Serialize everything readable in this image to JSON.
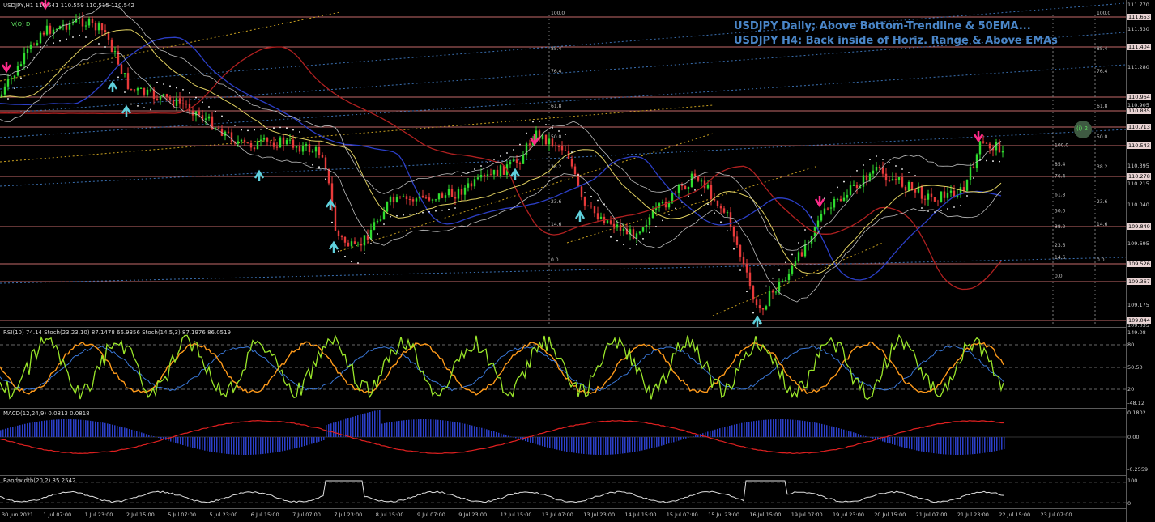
{
  "symbol_bar": "USDJPY,H1  110.541 110.559 110.515 110.542",
  "mode_badge": "V(O) D",
  "annotations": [
    "USDJPY Daily; Above Bottom-Trendline & 50EMA...",
    "USDJPY H4: Back inside of Horiz. Range & Above EMAs"
  ],
  "wave_label": "(i) 2",
  "price_axis": [
    "111.770",
    "111.653",
    "111.530",
    "111.404",
    "111.280",
    "110.964",
    "110.905",
    "110.835",
    "110.713",
    "110.543",
    "110.395",
    "110.278",
    "110.215",
    "110.040",
    "109.849",
    "109.695",
    "109.526",
    "109.367",
    "109.175",
    "109.044",
    "109.035"
  ],
  "highlight_prices": [
    "111.653",
    "111.404",
    "110.964",
    "110.835",
    "110.713",
    "110.543",
    "110.278",
    "109.849",
    "109.526",
    "109.367",
    "109.044"
  ],
  "fib_left": [
    "100.0",
    "85.4",
    "76.4",
    "61.8",
    "50.0",
    "38.2",
    "23.6",
    "14.6",
    "0.0"
  ],
  "fib_right": [
    "100.0",
    "85.4",
    "76.4",
    "61.8",
    "50.0",
    "38.2",
    "23.6",
    "14.6",
    "0.0"
  ],
  "fib_mid": [
    "100.0",
    "85.4",
    "76.4",
    "61.8",
    "50.0",
    "38.2",
    "23.6",
    "14.6",
    "0.0"
  ],
  "stoch_header": "RSI(10) 74.14  Stoch(23,23,10) 87.1478 66.9356  Stoch(14,5,3) 87.1976 86.0519",
  "stoch_axis": [
    "149.08",
    "80",
    "50.50",
    "20",
    "-48.12"
  ],
  "macd_header": "MACD(12,24,9) 0.0813 0.0818",
  "macd_axis": [
    "0.1802",
    "0.00",
    "-0.2559"
  ],
  "bandwidth_header": "Bandwidth(20,2) 35.2542",
  "bandwidth_axis": [
    "100",
    "0"
  ],
  "time_labels": [
    "30 Jun 2021",
    "1 Jul 07:00",
    "1 Jul 23:00",
    "2 Jul 15:00",
    "5 Jul 07:00",
    "5 Jul 23:00",
    "6 Jul 15:00",
    "7 Jul 07:00",
    "7 Jul 23:00",
    "8 Jul 15:00",
    "9 Jul 07:00",
    "9 Jul 23:00",
    "12 Jul 15:00",
    "13 Jul 07:00",
    "13 Jul 23:00",
    "14 Jul 15:00",
    "15 Jul 07:00",
    "15 Jul 23:00",
    "16 Jul 15:00",
    "19 Jul 07:00",
    "19 Jul 23:00",
    "20 Jul 15:00",
    "21 Jul 07:00",
    "21 Jul 23:00",
    "22 Jul 15:00",
    "23 Jul 07:00"
  ],
  "colors": {
    "background": "#000000",
    "bull_candle": "#2fdc2f",
    "bear_candle": "#e83a3a",
    "level_line": "#c46a6a",
    "annotation": "#4a86c8",
    "sell_arrow": "#ff2a8a",
    "buy_arrow": "#5fd0dc",
    "rsi": "#9ae62a",
    "stoch_fast": "#ff9a1a",
    "stoch_slow": "#3a78d8",
    "macd_hist": "#2b3fc8",
    "macd_signal": "#e02020",
    "bandwidth": "#e0e0e0"
  },
  "icons": [
    "sell-arrow-icon",
    "buy-arrow-icon",
    "wave-circle-icon"
  ]
}
